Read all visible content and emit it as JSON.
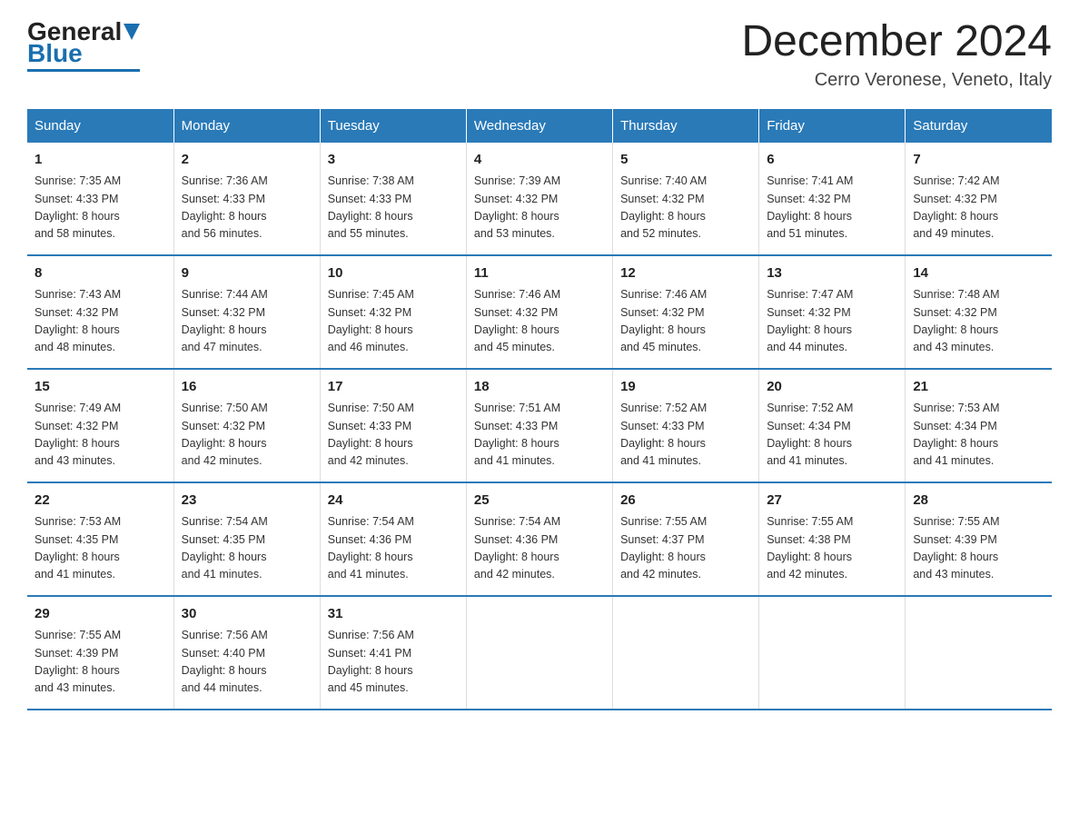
{
  "logo": {
    "general": "General",
    "blue": "Blue"
  },
  "title": "December 2024",
  "location": "Cerro Veronese, Veneto, Italy",
  "days_of_week": [
    "Sunday",
    "Monday",
    "Tuesday",
    "Wednesday",
    "Thursday",
    "Friday",
    "Saturday"
  ],
  "weeks": [
    [
      {
        "day": "1",
        "sunrise": "7:35 AM",
        "sunset": "4:33 PM",
        "daylight": "8 hours and 58 minutes."
      },
      {
        "day": "2",
        "sunrise": "7:36 AM",
        "sunset": "4:33 PM",
        "daylight": "8 hours and 56 minutes."
      },
      {
        "day": "3",
        "sunrise": "7:38 AM",
        "sunset": "4:33 PM",
        "daylight": "8 hours and 55 minutes."
      },
      {
        "day": "4",
        "sunrise": "7:39 AM",
        "sunset": "4:32 PM",
        "daylight": "8 hours and 53 minutes."
      },
      {
        "day": "5",
        "sunrise": "7:40 AM",
        "sunset": "4:32 PM",
        "daylight": "8 hours and 52 minutes."
      },
      {
        "day": "6",
        "sunrise": "7:41 AM",
        "sunset": "4:32 PM",
        "daylight": "8 hours and 51 minutes."
      },
      {
        "day": "7",
        "sunrise": "7:42 AM",
        "sunset": "4:32 PM",
        "daylight": "8 hours and 49 minutes."
      }
    ],
    [
      {
        "day": "8",
        "sunrise": "7:43 AM",
        "sunset": "4:32 PM",
        "daylight": "8 hours and 48 minutes."
      },
      {
        "day": "9",
        "sunrise": "7:44 AM",
        "sunset": "4:32 PM",
        "daylight": "8 hours and 47 minutes."
      },
      {
        "day": "10",
        "sunrise": "7:45 AM",
        "sunset": "4:32 PM",
        "daylight": "8 hours and 46 minutes."
      },
      {
        "day": "11",
        "sunrise": "7:46 AM",
        "sunset": "4:32 PM",
        "daylight": "8 hours and 45 minutes."
      },
      {
        "day": "12",
        "sunrise": "7:46 AM",
        "sunset": "4:32 PM",
        "daylight": "8 hours and 45 minutes."
      },
      {
        "day": "13",
        "sunrise": "7:47 AM",
        "sunset": "4:32 PM",
        "daylight": "8 hours and 44 minutes."
      },
      {
        "day": "14",
        "sunrise": "7:48 AM",
        "sunset": "4:32 PM",
        "daylight": "8 hours and 43 minutes."
      }
    ],
    [
      {
        "day": "15",
        "sunrise": "7:49 AM",
        "sunset": "4:32 PM",
        "daylight": "8 hours and 43 minutes."
      },
      {
        "day": "16",
        "sunrise": "7:50 AM",
        "sunset": "4:32 PM",
        "daylight": "8 hours and 42 minutes."
      },
      {
        "day": "17",
        "sunrise": "7:50 AM",
        "sunset": "4:33 PM",
        "daylight": "8 hours and 42 minutes."
      },
      {
        "day": "18",
        "sunrise": "7:51 AM",
        "sunset": "4:33 PM",
        "daylight": "8 hours and 41 minutes."
      },
      {
        "day": "19",
        "sunrise": "7:52 AM",
        "sunset": "4:33 PM",
        "daylight": "8 hours and 41 minutes."
      },
      {
        "day": "20",
        "sunrise": "7:52 AM",
        "sunset": "4:34 PM",
        "daylight": "8 hours and 41 minutes."
      },
      {
        "day": "21",
        "sunrise": "7:53 AM",
        "sunset": "4:34 PM",
        "daylight": "8 hours and 41 minutes."
      }
    ],
    [
      {
        "day": "22",
        "sunrise": "7:53 AM",
        "sunset": "4:35 PM",
        "daylight": "8 hours and 41 minutes."
      },
      {
        "day": "23",
        "sunrise": "7:54 AM",
        "sunset": "4:35 PM",
        "daylight": "8 hours and 41 minutes."
      },
      {
        "day": "24",
        "sunrise": "7:54 AM",
        "sunset": "4:36 PM",
        "daylight": "8 hours and 41 minutes."
      },
      {
        "day": "25",
        "sunrise": "7:54 AM",
        "sunset": "4:36 PM",
        "daylight": "8 hours and 42 minutes."
      },
      {
        "day": "26",
        "sunrise": "7:55 AM",
        "sunset": "4:37 PM",
        "daylight": "8 hours and 42 minutes."
      },
      {
        "day": "27",
        "sunrise": "7:55 AM",
        "sunset": "4:38 PM",
        "daylight": "8 hours and 42 minutes."
      },
      {
        "day": "28",
        "sunrise": "7:55 AM",
        "sunset": "4:39 PM",
        "daylight": "8 hours and 43 minutes."
      }
    ],
    [
      {
        "day": "29",
        "sunrise": "7:55 AM",
        "sunset": "4:39 PM",
        "daylight": "8 hours and 43 minutes."
      },
      {
        "day": "30",
        "sunrise": "7:56 AM",
        "sunset": "4:40 PM",
        "daylight": "8 hours and 44 minutes."
      },
      {
        "day": "31",
        "sunrise": "7:56 AM",
        "sunset": "4:41 PM",
        "daylight": "8 hours and 45 minutes."
      },
      null,
      null,
      null,
      null
    ]
  ],
  "labels": {
    "sunrise": "Sunrise:",
    "sunset": "Sunset:",
    "daylight": "Daylight:"
  }
}
